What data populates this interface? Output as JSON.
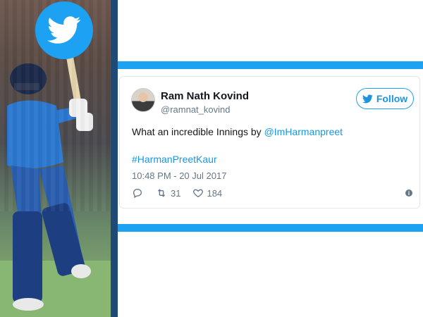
{
  "tweet": {
    "author_name": "Ram Nath Kovind",
    "author_handle": "@ramnat_kovind",
    "follow_label": "Follow",
    "text_prefix": "What an incredible Innings by ",
    "mention": "@ImHarmanpreet",
    "hashtag": "#HarmanPreetKaur",
    "timestamp": "10:48 PM - 20 Jul 2017",
    "retweets": "31",
    "likes": "184",
    "info_glyph": "i"
  },
  "colors": {
    "twitter_blue": "#1da1f2",
    "link_blue": "#1b95e0",
    "muted": "#657786",
    "dark_bar": "#1e4a78"
  },
  "icons": [
    "twitter-bird-icon",
    "reply-icon",
    "retweet-icon",
    "heart-icon",
    "info-icon"
  ]
}
